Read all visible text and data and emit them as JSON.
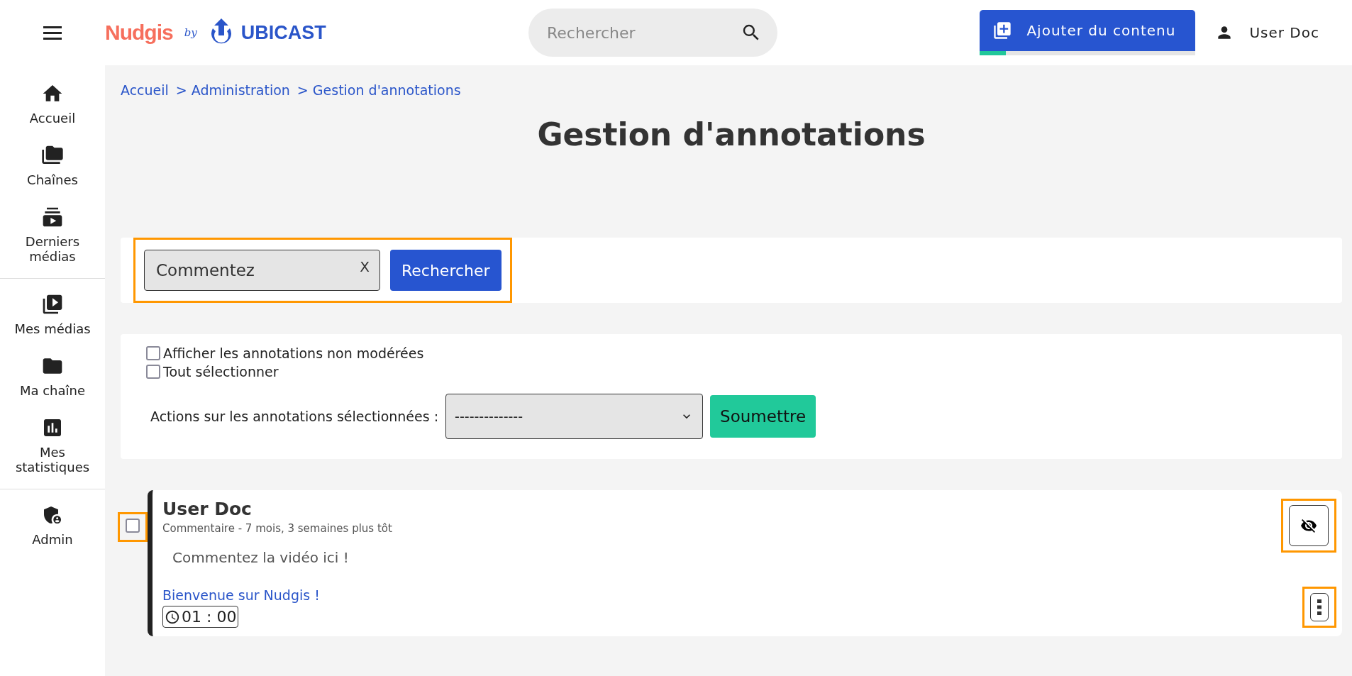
{
  "header": {
    "logo": {
      "brand": "Nudgis",
      "by": "by",
      "company": "UBICAST"
    },
    "search": {
      "placeholder": "Rechercher"
    },
    "add_button": {
      "label": "Ajouter du contenu",
      "level": 0.12
    },
    "user": "User Doc"
  },
  "sidebar": {
    "groups": [
      [
        {
          "label": "Accueil"
        },
        {
          "label": "Chaînes"
        },
        {
          "label": "Derniers médias"
        }
      ],
      [
        {
          "label": "Mes médias"
        },
        {
          "label": "Ma chaîne"
        },
        {
          "label": "Mes statistiques"
        }
      ],
      [
        {
          "label": "Admin"
        }
      ]
    ]
  },
  "breadcrumb": [
    "Accueil",
    "> Administration",
    "> Gestion d'annotations"
  ],
  "title": "Gestion d'annotations",
  "search_form": {
    "value": "Commentez",
    "clear": "X",
    "button": "Rechercher",
    "highlighted": true
  },
  "filters": {
    "options": [
      {
        "label": "Afficher les annotations non modérées",
        "checked": false
      },
      {
        "label": "Tout sélectionner",
        "checked": false
      }
    ],
    "actions_label": "Actions sur les annotations sélectionnées :",
    "select_value": "--------------",
    "submit": "Soumettre"
  },
  "annotations": [
    {
      "checked": false,
      "author": "User Doc",
      "meta": "Commentaire - 7 mois, 3 semaines plus tôt",
      "text": "Commentez la vidéo ici !",
      "link": "Bienvenue sur Nudgis !",
      "time": "01 : 00",
      "highlighted": true
    }
  ]
}
